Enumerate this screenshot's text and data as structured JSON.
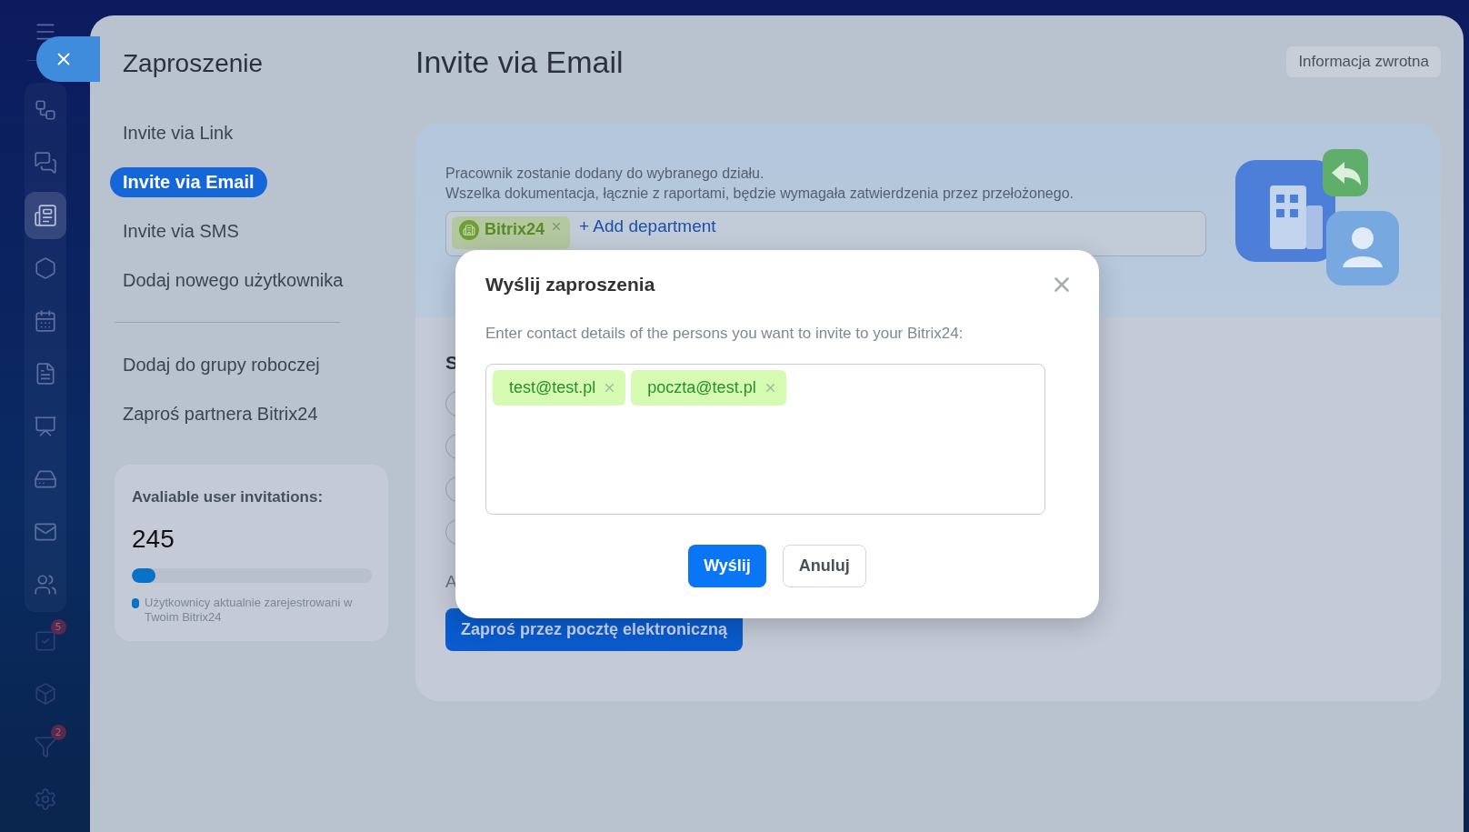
{
  "rail": {
    "items": [
      {
        "selected": false
      },
      {
        "selected": false
      },
      {
        "selected": true
      },
      {
        "selected": false
      },
      {
        "selected": false
      },
      {
        "selected": false
      },
      {
        "selected": false
      },
      {
        "selected": false
      },
      {
        "selected": false
      },
      {
        "selected": false
      },
      {
        "selected": false,
        "badge": "5"
      },
      {
        "selected": false
      },
      {
        "selected": false,
        "badge": "2"
      },
      {
        "selected": false
      }
    ]
  },
  "panel": {
    "title": "Zaproszenie",
    "nav": [
      {
        "label": "Invite via Link",
        "selected": false
      },
      {
        "label": "Invite via Email",
        "selected": true
      },
      {
        "label": "Invite via SMS",
        "selected": false
      },
      {
        "label": "Dodaj nowego użytkownika",
        "selected": false
      }
    ],
    "nav_secondary": [
      {
        "label": "Dodaj do grupy roboczej",
        "selected": false
      },
      {
        "label": "Zaproś partnera Bitrix24",
        "selected": false
      }
    ],
    "invitations_card": {
      "title": "Avaliable user invitations:",
      "count": "245",
      "level": 0.1,
      "legend": "Użytkownicy aktualnie zarejestrowani w Twoim Bitrix24"
    }
  },
  "main": {
    "title": "Invite via Email",
    "feedback_button": "Informacja zwrotna",
    "description": [
      "Pracownik zostanie dodany do wybranego działu.",
      "Wszelka dokumentacja, łącznie z raportami, będzie wymagała zatwierdzenia przez przełożonego."
    ],
    "departments": [
      {
        "label": "Bitrix24"
      }
    ],
    "add_department": "+ Add department",
    "section_heading": "S",
    "footer_text": "A",
    "submit_button": "Zaproś przez pocztę elektroniczną"
  },
  "dialog": {
    "title": "Wyślij zaproszenia",
    "hint": "Enter contact details of the persons you want to invite to your Bitrix24:",
    "recipients": [
      {
        "label": "test@test.pl"
      },
      {
        "label": "poczta@test.pl"
      }
    ],
    "buttons": [
      {
        "label": "Wyślij",
        "kind": "primary"
      },
      {
        "label": "Anuluj",
        "kind": "secondary"
      }
    ]
  }
}
